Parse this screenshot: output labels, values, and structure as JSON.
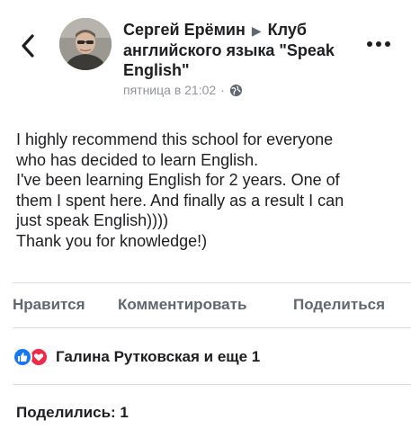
{
  "post": {
    "author": "Сергей Ерёмин",
    "group": "Клуб английского языка \"Speak English\"",
    "timestamp": "пятница в 21:02",
    "meta_dot": "·",
    "privacy_icon": "globe-icon",
    "text_lines": [
      "I highly recommend this school for everyone",
      "who has decided to learn English.",
      "I've been learning English for 2 years. One of",
      "them I spent here. And finally as a result I can",
      "just speak English))))",
      "Thank you for knowledge!)"
    ]
  },
  "actions": {
    "like": "Нравится",
    "comment": "Комментировать",
    "share": "Поделиться"
  },
  "reactions": {
    "icons": [
      "like-reaction-icon",
      "love-reaction-icon"
    ],
    "text": "Галина Рутковская и еще 1"
  },
  "shares": "Поделились: 1",
  "colors": {
    "like": "#1877f2",
    "love": "#f0284a",
    "muted": "#606770"
  }
}
